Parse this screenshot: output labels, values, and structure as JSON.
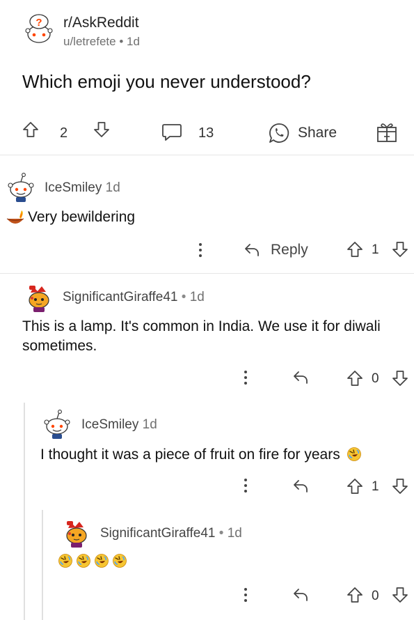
{
  "post": {
    "subreddit": "r/AskReddit",
    "author": "u/letrefete",
    "dot": "•",
    "age": "1d",
    "title": "Which emoji you never understood?",
    "upvotes": "2",
    "comments": "13",
    "share_label": "Share"
  },
  "comments": [
    {
      "user": "IceSmiley",
      "time": "1d",
      "dot": "",
      "text": "Very bewildering",
      "emoji": [
        "diya-lamp"
      ],
      "reply_label": "Reply",
      "votes": "1"
    },
    {
      "user": "SignificantGiraffe41",
      "time": "1d",
      "dot": "•",
      "text": "This is a lamp. It's common in India. We use it for diwali sometimes.",
      "votes": "0"
    },
    {
      "user": "IceSmiley",
      "time": "1d",
      "dot": "",
      "text": "I thought it was a piece of fruit on fire for years",
      "emoji": [
        "rolling-on-floor-laughing"
      ],
      "votes": "1"
    },
    {
      "user": "SignificantGiraffe41",
      "time": "1d",
      "dot": "•",
      "text": "",
      "emoji": [
        "rolling-on-floor-laughing",
        "rolling-on-floor-laughing",
        "rolling-on-floor-laughing",
        "rolling-on-floor-laughing"
      ],
      "votes": "0"
    }
  ],
  "colors": {
    "text": "#1a1a1b",
    "muted": "#707070",
    "icon": "#444444",
    "divider": "#e6e6e6",
    "emoji_yellow": "#f7c531"
  }
}
